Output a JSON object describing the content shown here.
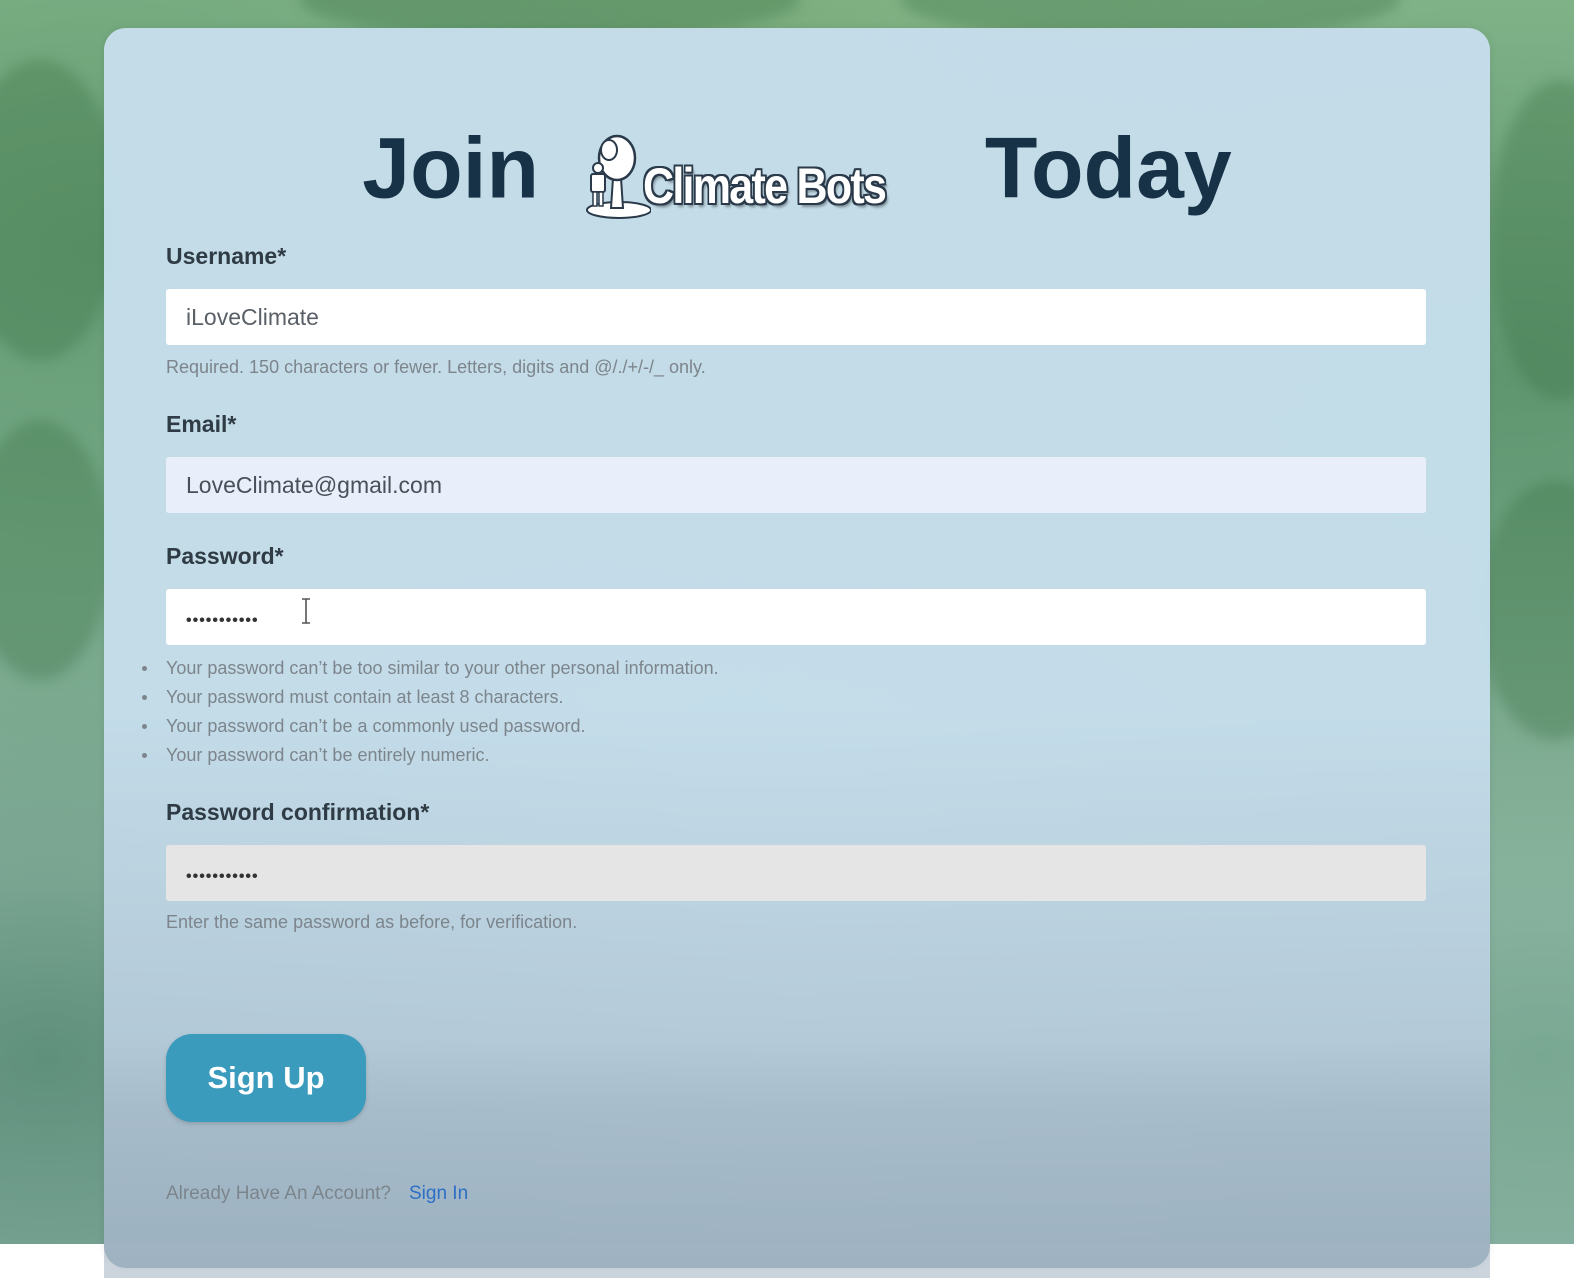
{
  "page": {
    "heading_before": "Join",
    "heading_after": "Today",
    "logo_text": "Climate Bots",
    "accent_color": "#3a9bbd"
  },
  "form": {
    "username": {
      "label": "Username*",
      "value": "iLoveClimate",
      "help": "Required. 150 characters or fewer. Letters, digits and @/./+/-/_ only."
    },
    "email": {
      "label": "Email*",
      "value": "LoveClimate@gmail.com"
    },
    "password": {
      "label": "Password*",
      "value": "•••••••••••",
      "rules": [
        "Your password can’t be too similar to your other personal information.",
        "Your password must contain at least 8 characters.",
        "Your password can’t be a commonly used password.",
        "Your password can’t be entirely numeric."
      ]
    },
    "password_confirmation": {
      "label": "Password confirmation*",
      "value": "•••••••••••",
      "help": "Enter the same password as before, for verification."
    },
    "submit_label": "Sign Up"
  },
  "footer": {
    "prompt": "Already Have An Account?",
    "link_label": "Sign In"
  }
}
